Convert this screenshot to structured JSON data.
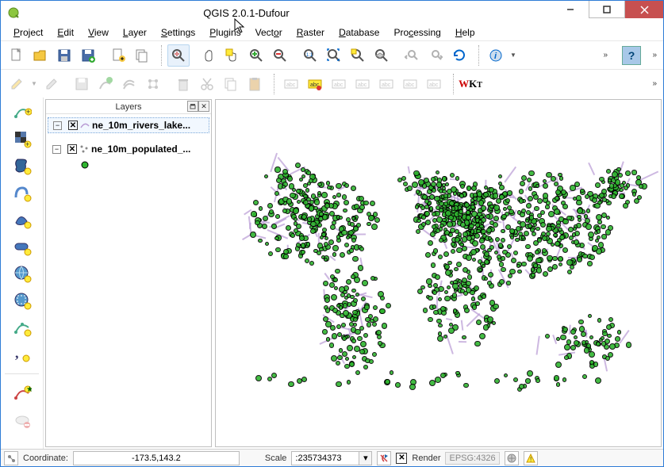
{
  "window": {
    "title": "QGIS 2.0.1-Dufour"
  },
  "menu": [
    {
      "label": "Project",
      "u": 0
    },
    {
      "label": "Edit",
      "u": 0
    },
    {
      "label": "View",
      "u": 0
    },
    {
      "label": "Layer",
      "u": 0
    },
    {
      "label": "Settings",
      "u": 0
    },
    {
      "label": "Plugins",
      "u": 0
    },
    {
      "label": "Vector",
      "u": 3
    },
    {
      "label": "Raster",
      "u": 0
    },
    {
      "label": "Database",
      "u": 0
    },
    {
      "label": "Processing",
      "u": 3
    },
    {
      "label": "Help",
      "u": 0
    }
  ],
  "layers_panel": {
    "title": "Layers",
    "items": [
      {
        "name": "ne_10m_rivers_lake...",
        "checked": true,
        "expanded": false,
        "selected": true,
        "symbol": "line",
        "color": "#b89ad4"
      },
      {
        "name": "ne_10m_populated_...",
        "checked": true,
        "expanded": true,
        "selected": false,
        "symbol": "point",
        "color": "#2fb52f"
      }
    ]
  },
  "statusbar": {
    "coord_label": "Coordinate:",
    "coord_value": "-173.5,143.2",
    "scale_label": "Scale",
    "scale_value": ":235734373",
    "render_label": "Render",
    "render_checked": true,
    "epsg": "EPSG:4326"
  },
  "icons": {
    "wkt": "WKT"
  }
}
